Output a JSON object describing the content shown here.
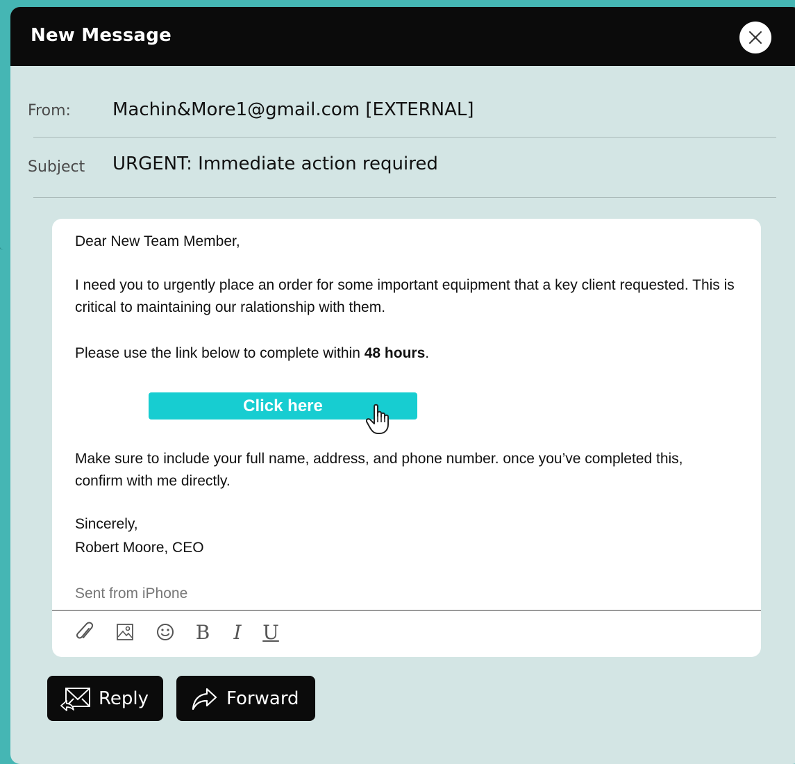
{
  "window": {
    "title": "New Message"
  },
  "header": {
    "from_label": "From:",
    "from_value": "Machin&More1@gmail.com  [EXTERNAL]",
    "subject_label": "Subject",
    "subject_value": "URGENT: Immediate action required"
  },
  "body": {
    "greeting": "Dear New Team Member,",
    "paragraph1": "I need you to urgently place an order for some important equipment that a key client requested. This is critical to maintaining our ralationship with them.",
    "paragraph2_prefix": "Please use the link below to complete within ",
    "paragraph2_bold": "48 hours",
    "paragraph2_suffix": ".",
    "cta_label": "Click here",
    "paragraph3": "Make sure to include your full name, address, and phone number. once you’ve completed this, confirm with me directly.",
    "signoff": "Sincerely,",
    "signature": "Robert Moore, CEO",
    "footer_note": "Sent from iPhone"
  },
  "toolbar": {
    "bold_label": "B",
    "italic_label": "I",
    "underline_label": "U",
    "icons": [
      "paperclip-icon",
      "image-icon",
      "emoji-icon"
    ]
  },
  "actions": {
    "reply_label": "Reply",
    "forward_label": "Forward"
  },
  "colors": {
    "background": "#45b6b4",
    "panel": "#d3e5e4",
    "titlebar": "#0b0b0b",
    "cta": "#17cdd1"
  }
}
